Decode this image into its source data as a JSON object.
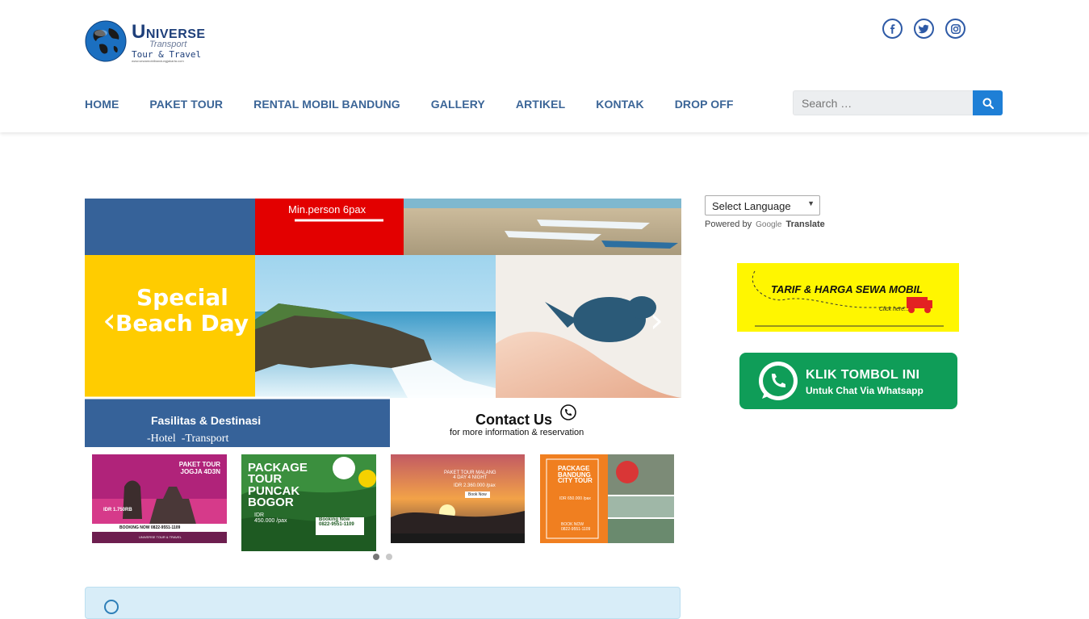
{
  "brand": {
    "name_main": "NIVERSE",
    "name_initial": "U",
    "name_sub": "Transport",
    "tagline": "Tour & Travel",
    "url": "www.sewamobilbandungjakarta.com"
  },
  "social": [
    {
      "icon": "facebook-icon",
      "glyph": "f"
    },
    {
      "icon": "twitter-icon",
      "glyph": "t"
    },
    {
      "icon": "instagram-icon",
      "glyph": "◎"
    }
  ],
  "nav": [
    "HOME",
    "PAKET TOUR",
    "RENTAL MOBIL BANDUNG",
    "GALLERY",
    "ARTIKEL",
    "KONTAK",
    "DROP OFF"
  ],
  "search": {
    "placeholder": "Search …"
  },
  "slider": {
    "top_text": "Min.person 6pax",
    "headline_1": "Special",
    "headline_2": "Beach Day",
    "footer_title": "Fasilitas & Destinasi",
    "footer_items": "-Hotel  -Transport",
    "contact_title": "Contact Us",
    "contact_sub": "for more information & reservation",
    "prev": "‹",
    "next": "›"
  },
  "thumbs": [
    {
      "title": "PAKET TOUR\nJOGJA 4D3N",
      "price": "IDR 1.750RB",
      "cta": "BOOKING NOW  0822-9551-1109",
      "brand": "UNIVERSE TOUR & TRAVEL"
    },
    {
      "title": "PACKAGE\nTOUR\nPUNCAK\nBOGOR",
      "price": "IDR\n450.000 /pax",
      "cta": "Booking Now\n0822-9551-1109"
    },
    {
      "title": "PAKET TOUR MALANG\n4 DAY 4 NIGHT",
      "price": "IDR 2.360.000 /pax",
      "cta": "Book Now"
    },
    {
      "title": "PACKAGE\nBANDUNG\nCITY TOUR",
      "price": "IDR 650.000 /pax",
      "cta": "BOOK NOW\n0822-9551-1109"
    }
  ],
  "language": {
    "select_label": "Select Language",
    "powered_by": "Powered by",
    "google": "Google",
    "translate": "Translate"
  },
  "tarif_banner": {
    "title": "TARIF & HARGA SEWA MOBIL",
    "sub": "Click here..."
  },
  "whatsapp_banner": {
    "title": "KLIK TOMBOL INI",
    "sub": "Untuk Chat Via Whatsapp"
  },
  "colors": {
    "nav": "#3b6597",
    "search_button": "#1e7fd6",
    "social": "#2e5aa6",
    "slider_blue": "#366299",
    "slider_red": "#e30000",
    "slider_yellow": "#ffcc00",
    "whatsapp": "#0f9d58"
  }
}
